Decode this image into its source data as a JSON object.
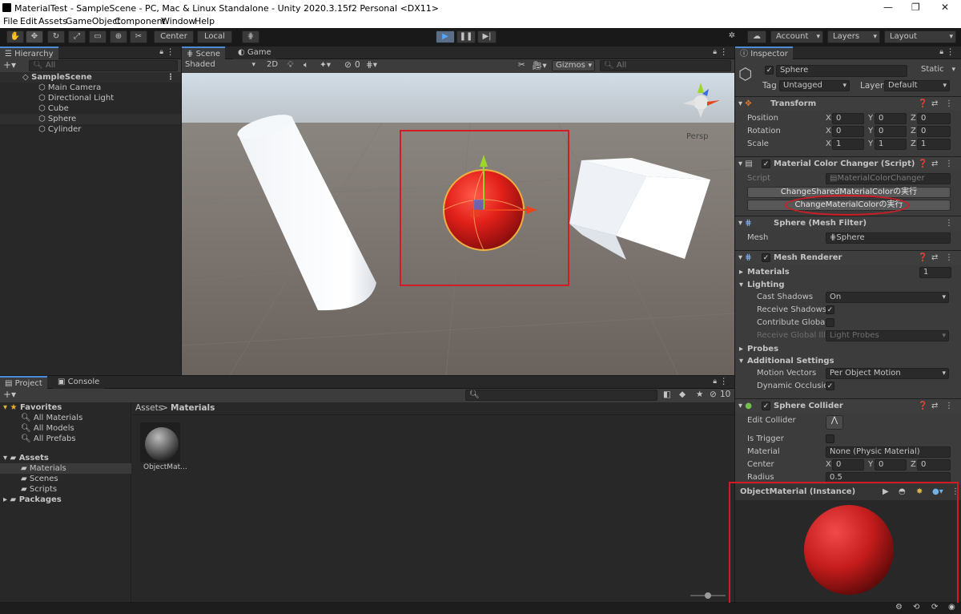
{
  "window": {
    "title": "MaterialTest - SampleScene - PC, Mac & Linux Standalone - Unity 2020.3.15f2 Personal <DX11>",
    "min": "—",
    "max": "❐",
    "close": "✕"
  },
  "menu": [
    "File",
    "Edit",
    "Assets",
    "GameObject",
    "Component",
    "Window",
    "Help"
  ],
  "toolbar": {
    "center": "Center",
    "local": "Local",
    "account": "Account",
    "layers": "Layers",
    "layout": "Layout"
  },
  "hierarchy": {
    "tab": "Hierarchy",
    "search_placeholder": "All",
    "scene": "SampleScene",
    "items": [
      "Main Camera",
      "Directional Light",
      "Cube",
      "Sphere",
      "Cylinder"
    ]
  },
  "scene": {
    "tab_scene": "Scene",
    "tab_game": "Game",
    "shading": "Shaded",
    "mode2d": "2D",
    "hidden_count": "0",
    "gizmos": "Gizmos",
    "search_placeholder": "All",
    "persp": "Persp"
  },
  "project": {
    "tab_project": "Project",
    "tab_console": "Console",
    "hidden_count": "10",
    "favorites": "Favorites",
    "fav_items": [
      "All Materials",
      "All Models",
      "All Prefabs"
    ],
    "assets": "Assets",
    "asset_items": [
      "Materials",
      "Scenes",
      "Scripts"
    ],
    "packages": "Packages",
    "breadcrumb_root": "Assets",
    "breadcrumb_sep": ">",
    "breadcrumb_current": "Materials",
    "asset_name": "ObjectMat..."
  },
  "inspector": {
    "tab": "Inspector",
    "name": "Sphere",
    "static": "Static",
    "tag_label": "Tag",
    "tag": "Untagged",
    "layer_label": "Layer",
    "layer": "Default",
    "transform": {
      "title": "Transform",
      "position": "Position",
      "rotation": "Rotation",
      "scale": "Scale",
      "x": "X",
      "y": "Y",
      "z": "Z",
      "pos": [
        "0",
        "0",
        "0"
      ],
      "rot": [
        "0",
        "0",
        "0"
      ],
      "scl": [
        "1",
        "1",
        "1"
      ]
    },
    "script_comp": {
      "title": "Material Color Changer (Script)",
      "script_label": "Script",
      "script_value": "MaterialColorChanger",
      "btn1": "ChangeSharedMaterialColorの実行",
      "btn2": "ChangeMaterialColorの実行"
    },
    "mesh_filter": {
      "title": "Sphere (Mesh Filter)",
      "mesh_label": "Mesh",
      "mesh_value": "Sphere"
    },
    "mesh_renderer": {
      "title": "Mesh Renderer",
      "materials": "Materials",
      "materials_count": "1",
      "lighting": "Lighting",
      "cast_shadows": "Cast Shadows",
      "cast_shadows_value": "On",
      "receive_shadows": "Receive Shadows",
      "contribute_global": "Contribute Global",
      "receive_global": "Receive Global Ill",
      "receive_global_value": "Light Probes",
      "probes": "Probes",
      "additional": "Additional Settings",
      "motion_vectors": "Motion Vectors",
      "motion_vectors_value": "Per Object Motion",
      "dynamic_occlusion": "Dynamic Occlusio"
    },
    "sphere_collider": {
      "title": "Sphere Collider",
      "edit_collider": "Edit Collider",
      "is_trigger": "Is Trigger",
      "material": "Material",
      "material_value": "None (Physic Material)",
      "center": "Center",
      "center_vals": [
        "0",
        "0",
        "0"
      ],
      "radius": "Radius",
      "radius_value": "0.5"
    },
    "preview": {
      "title": "ObjectMaterial (Instance)"
    }
  },
  "colors": {
    "accent": "#4d8cd6",
    "highlight": "#d11c25",
    "sphere": "#d82a2a"
  }
}
